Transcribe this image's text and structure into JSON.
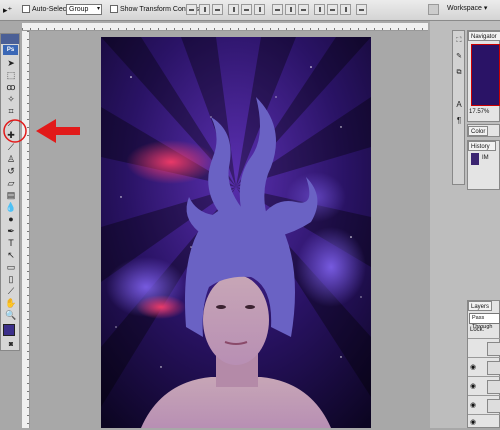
{
  "options_bar": {
    "auto_select_label": "Auto-Select:",
    "auto_select_value": "Group",
    "show_transform_label": "Show Transform Controls",
    "workspace_label": "Workspace"
  },
  "toolbox": {
    "app_badge": "Ps"
  },
  "navigator": {
    "tab_label": "Navigator",
    "zoom_value": "17.57%"
  },
  "color_panel": {
    "tab_label": "Color"
  },
  "history": {
    "tab_label": "History",
    "item_label": "IM"
  },
  "layers": {
    "tab_label": "Layers",
    "blend_mode": "Pass Through",
    "lock_label": "Lock:"
  },
  "colors": {
    "annotation": "#e21a1a",
    "foreground": "#3b2f8a",
    "hair": "#6a62c4",
    "space_bg": "#1a0c3c"
  }
}
